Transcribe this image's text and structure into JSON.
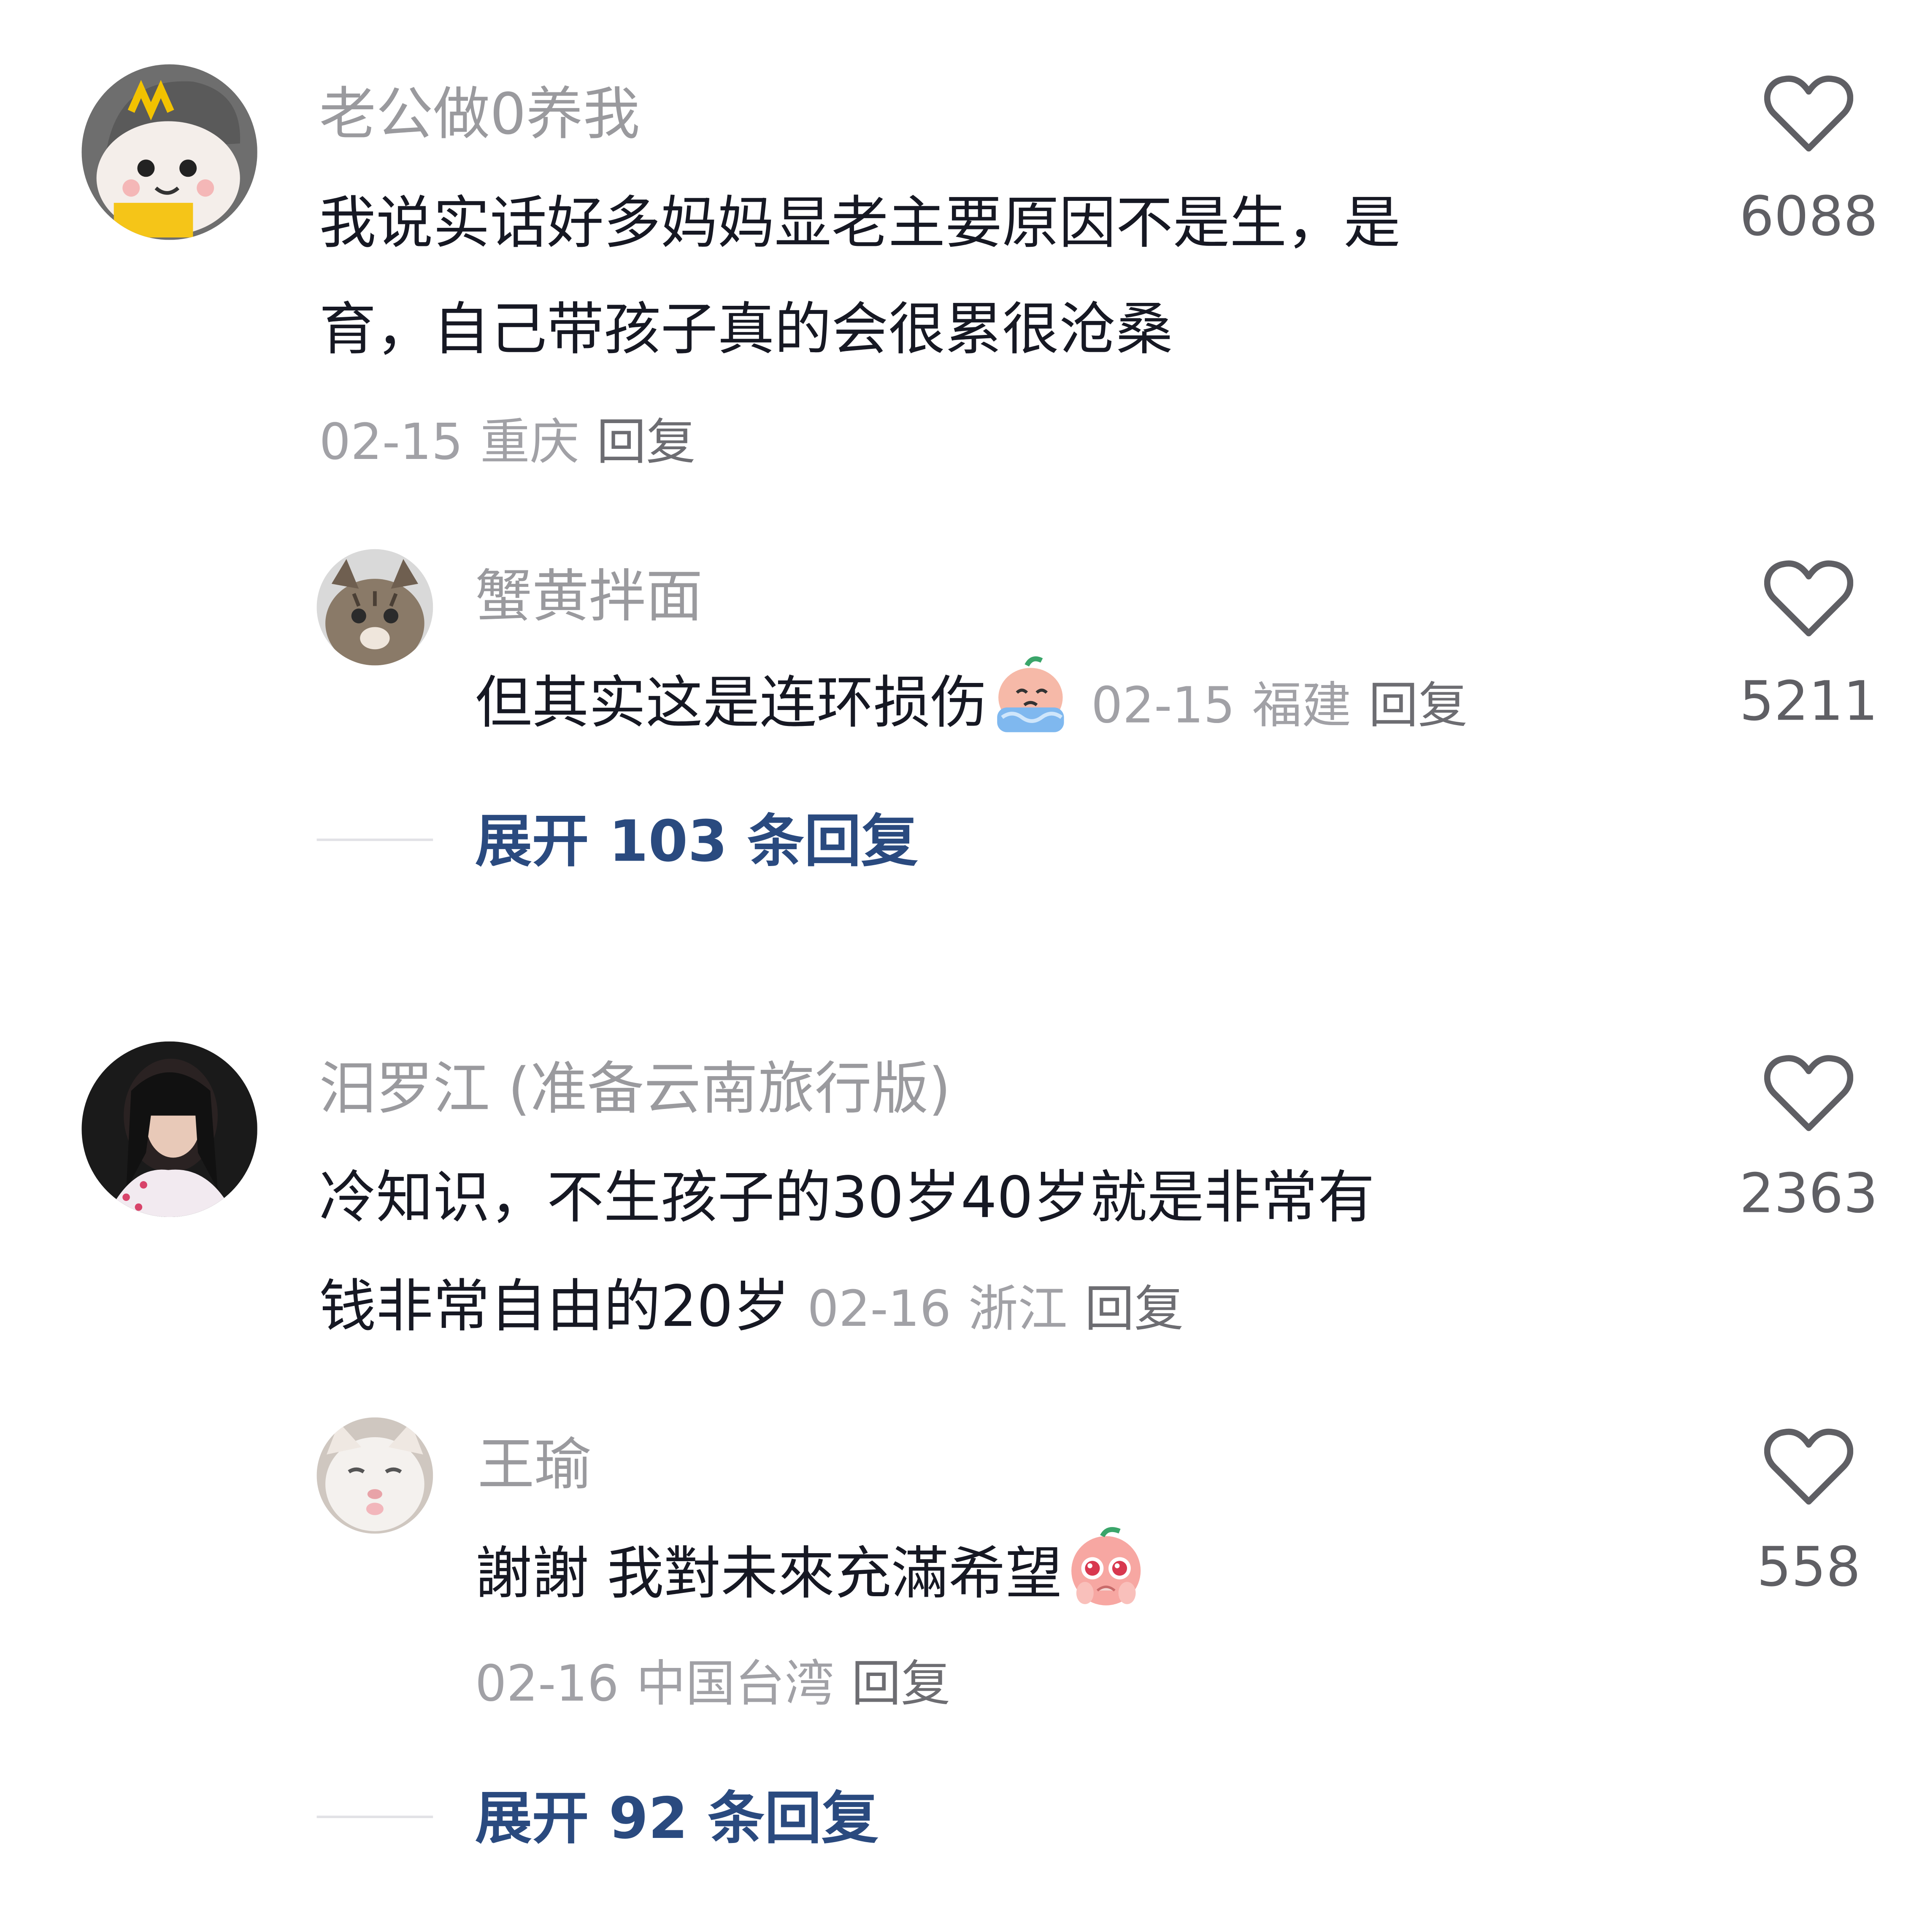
{
  "comments": [
    {
      "username": "老公做0养我",
      "text_line1": "我说实话好多妈妈显老主要原因不是生，是",
      "text_line2": "育，自己带孩子真的会很累很沧桑",
      "date": "02-15",
      "region": "重庆",
      "reply_label": "回复",
      "likes": "6088",
      "avatar_icon": "avatar-cartoon-cap",
      "replies": [
        {
          "username": "蟹黄拌面",
          "text": "但其实这是连环损伤",
          "emoji": "crying-emoji",
          "date": "02-15",
          "region": "福建",
          "reply_label": "回复",
          "likes": "5211",
          "avatar_icon": "avatar-cat-tabby"
        }
      ],
      "expand_label": "展开 103 条回复"
    },
    {
      "username": "汨罗江 (准备云南旅行版)",
      "text_line1": "冷知识，不生孩子的30岁40岁就是非常有",
      "text_line2": "钱非常自由的20岁",
      "date": "02-16",
      "region": "浙江",
      "reply_label": "回复",
      "likes": "2363",
      "avatar_icon": "avatar-woman-portrait",
      "replies": [
        {
          "username": "王瑜",
          "text": "謝謝 我對未來充滿希望",
          "emoji": "hopeful-emoji",
          "date": "02-16",
          "region": "中国台湾",
          "reply_label": "回复",
          "likes": "558",
          "avatar_icon": "avatar-cat-white"
        }
      ],
      "expand_label": "展开 92 条回复"
    }
  ],
  "colors": {
    "username": "#9a9a9e",
    "body_text": "#161823",
    "meta": "#a1a1a6",
    "link_blue": "#2a4a7f",
    "like_icon": "#5f5f64"
  },
  "like_icon": "heart-outline-icon"
}
